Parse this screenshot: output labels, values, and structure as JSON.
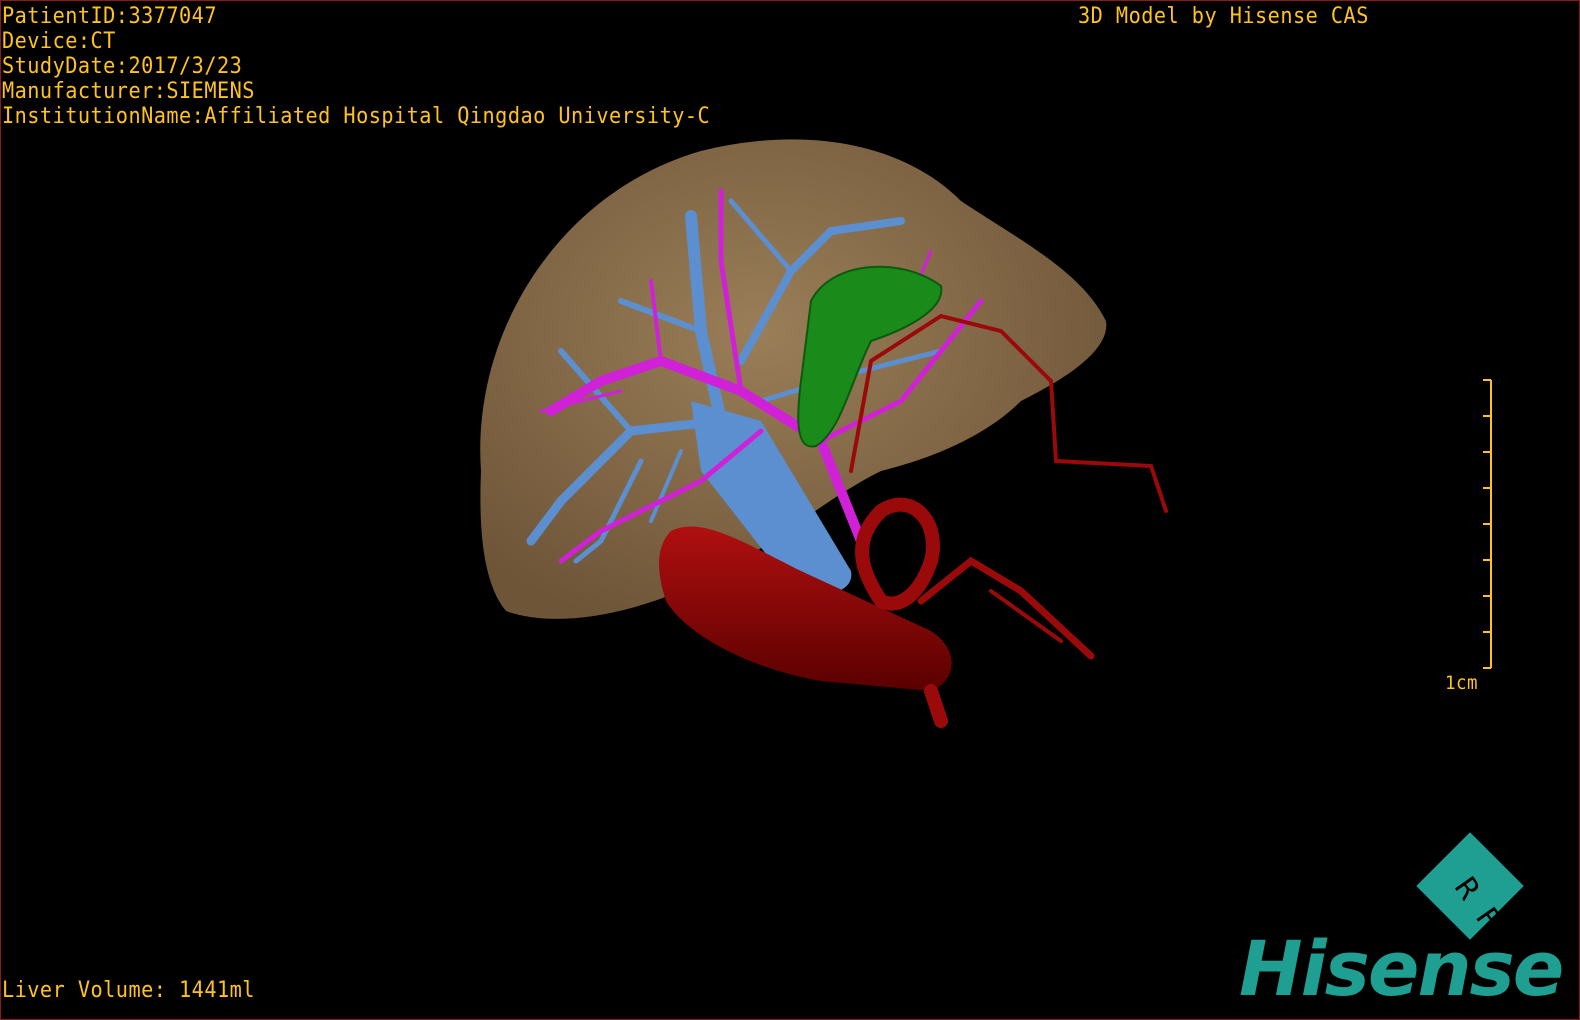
{
  "overlay": {
    "patient_id": "PatientID:3377047",
    "device": "Device:CT",
    "study_date": "StudyDate:2017/3/23",
    "manufacturer": "Manufacturer:SIEMENS",
    "institution": "InstitutionName:Affiliated Hospital Qingdao University-C",
    "brand_caption": "3D Model by Hisense CAS",
    "liver_volume": "Liver Volume: 1441ml"
  },
  "scale_bar": {
    "label": "1cm",
    "tick_count": 9
  },
  "logo": {
    "badge_text": "R F",
    "wordmark": "Hisense"
  },
  "colors": {
    "text": "#ffc31f",
    "liver": "#8a7050",
    "hepatic_vein": "#5b8fd0",
    "portal_vein": "#d020d8",
    "gallbladder": "#1a8a1a",
    "artery": "#9a0a0a",
    "logo": "#1f9e92"
  }
}
